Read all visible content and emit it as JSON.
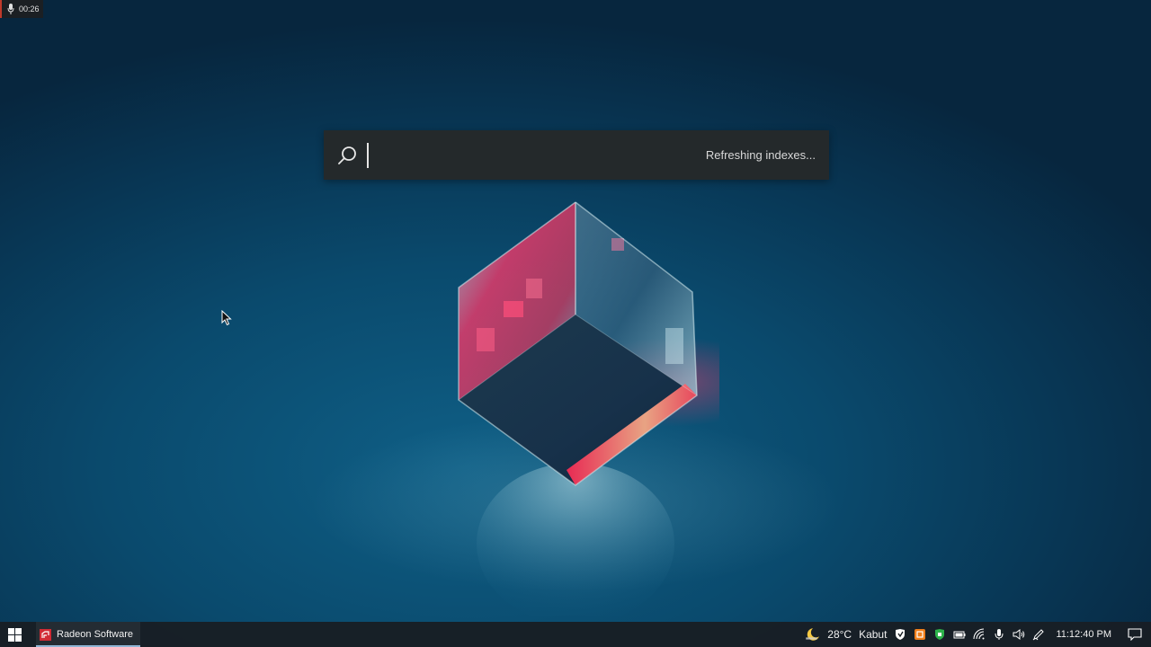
{
  "recording": {
    "elapsed": "00:26"
  },
  "search": {
    "value": "",
    "status": "Refreshing indexes..."
  },
  "taskbar": {
    "apps": [
      {
        "label": "Radeon Software",
        "icon": "radeon-icon"
      }
    ],
    "weather": {
      "temperature": "28°C",
      "condition": "Kabut",
      "icon": "moon-icon"
    },
    "tray_icons": [
      "security-icon",
      "app-orange-icon",
      "shield-green-icon",
      "battery-icon",
      "wifi-icon",
      "microphone-icon",
      "volume-icon",
      "pen-icon"
    ],
    "clock": "11:12:40 PM",
    "notification_icon": "notification-icon"
  },
  "colors": {
    "taskbar_bg": "#181e24",
    "search_bg": "#24292b",
    "radeon_red": "#d12b35",
    "active_underline": "#8fb5d4"
  }
}
